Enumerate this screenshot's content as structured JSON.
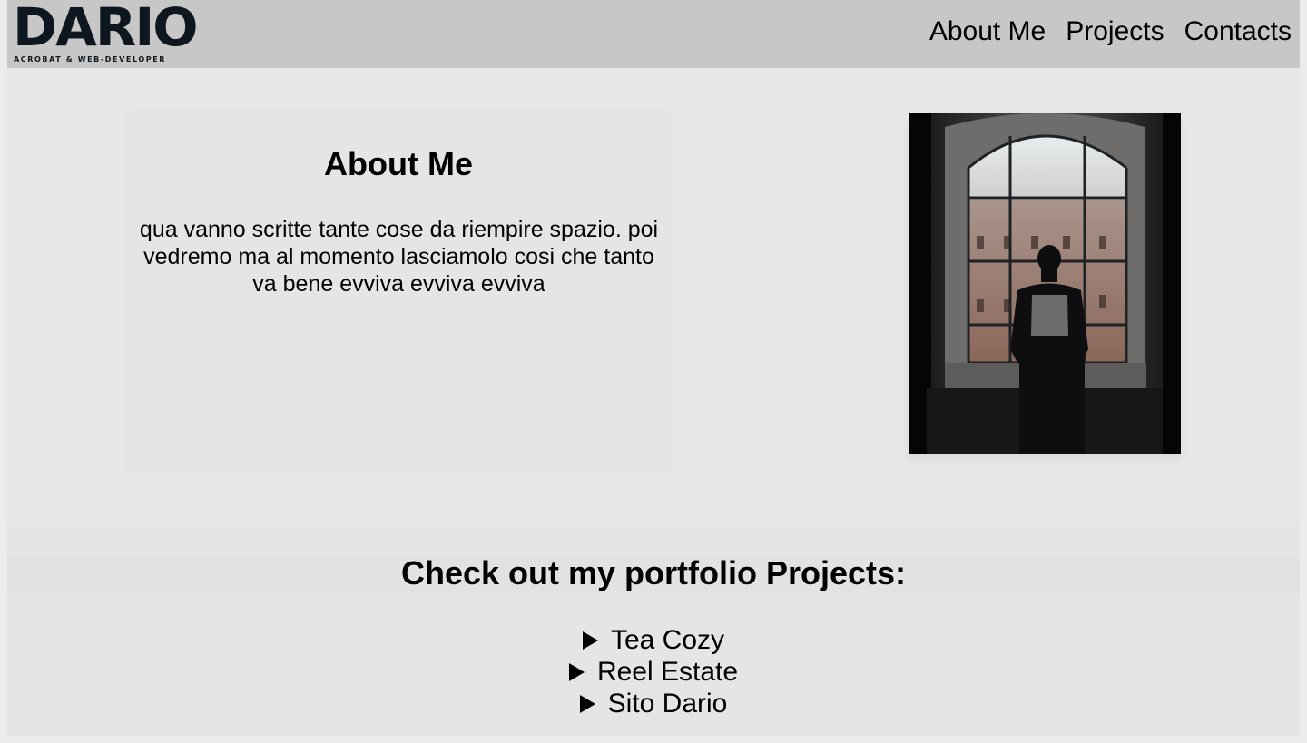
{
  "logo": {
    "word": "DARIO",
    "tagline": "ACROBAT & WEB-DEVELOPER"
  },
  "nav": {
    "items": [
      "About Me",
      "Projects",
      "Contacts"
    ]
  },
  "about": {
    "title": "About Me",
    "text": "qua vanno scritte tante cose da riempire spazio. poi vedremo ma al momento lasciamolo cosi che tanto va bene evviva evviva evviva"
  },
  "photo": {
    "icon": "portrait-photo"
  },
  "projects": {
    "title": "Check out my portfolio Projects:",
    "items": [
      "Tea Cozy",
      "Reel Estate",
      "Sito Dario"
    ],
    "marker_icon": "disclosure-triangle-icon"
  },
  "colors": {
    "header_bg": "#c6c7c6",
    "page_bg": "#e7e7e7",
    "logo": "#0e171f"
  }
}
